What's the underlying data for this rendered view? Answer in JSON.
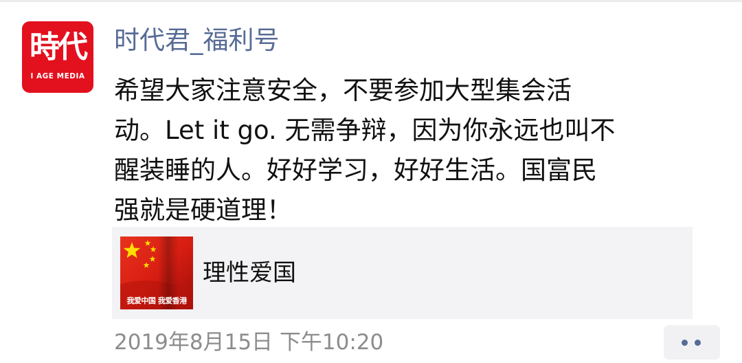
{
  "post": {
    "avatar": {
      "title": "時代",
      "subtitle": "I AGE MEDIA",
      "brand_color": "#e3101e"
    },
    "author": "时代君_福利号",
    "text_lines": [
      "希望大家注意安全，不要参加大型集会活",
      "动。Let it go. 无需争辩，因为你永远也叫不",
      "醒装睡的人。好好学习，好好生活。国富民",
      "强就是硬道理！"
    ],
    "share": {
      "title": "理性爱国",
      "thumbnail_caption": "我爱中国 我爱香港",
      "thumbnail_icon": "chinese-flag-image"
    },
    "timestamp": "2019年8月15日 下午10:20",
    "more_icon": "two-dots-icon",
    "colors": {
      "link_blue": "#576b95",
      "text": "#111111",
      "meta_gray": "#8c8c8c",
      "card_bg": "#f3f3f5"
    }
  }
}
